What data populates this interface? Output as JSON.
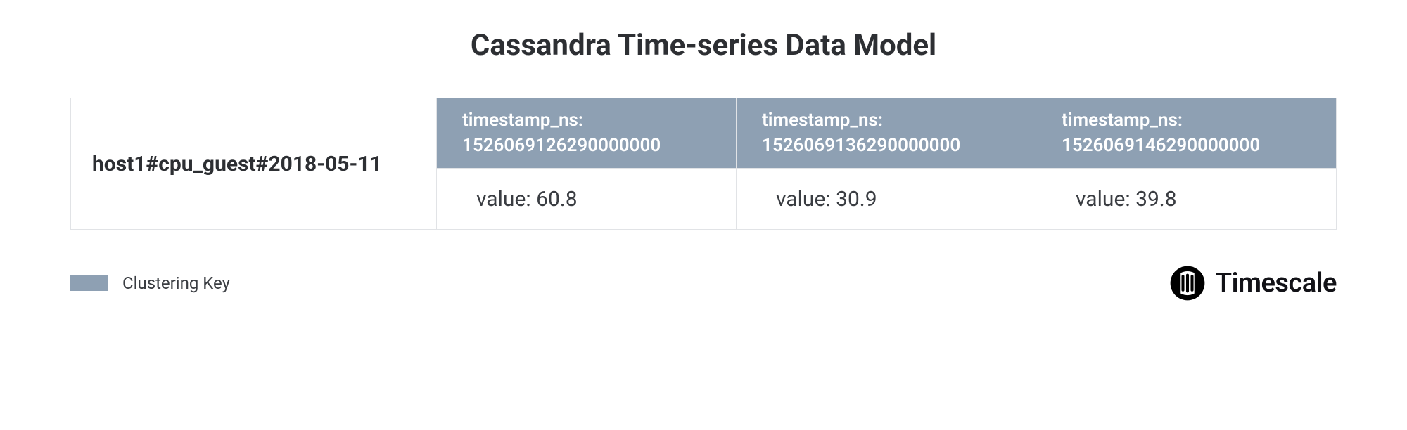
{
  "title": "Cassandra Time-series Data Model",
  "row_key": "host1#cpu_guest#2018-05-11",
  "columns": [
    {
      "ts_label": "timestamp_ns:",
      "ts_value": "1526069126290000000",
      "value_label": "value: 60.8"
    },
    {
      "ts_label": "timestamp_ns:",
      "ts_value": "1526069136290000000",
      "value_label": "value: 30.9"
    },
    {
      "ts_label": "timestamp_ns:",
      "ts_value": "1526069146290000000",
      "value_label": "value: 39.8"
    }
  ],
  "legend": {
    "label": "Clustering Key",
    "color": "#8ea0b3"
  },
  "brand": "Timescale"
}
